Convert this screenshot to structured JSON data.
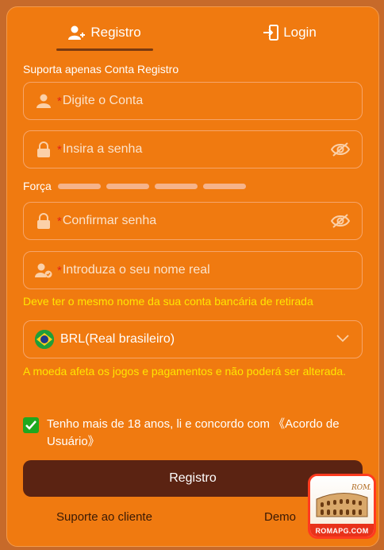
{
  "tabs": {
    "register": "Registro",
    "login": "Login"
  },
  "form": {
    "section_label": "Suporta apenas Conta Registro",
    "required_mark": "*",
    "account_placeholder": "Digite o Conta",
    "password_placeholder": "Insira a senha",
    "strength_label": "Força",
    "confirm_placeholder": "Confirmar senha",
    "realname_placeholder": "Introduza o seu nome real",
    "realname_hint": "Deve ter o mesmo nome da sua conta bancária de retirada",
    "currency_value": "BRL(Real brasileiro)",
    "currency_hint": "A moeda afeta os jogos e pagamentos e não poderá ser alterada.",
    "agree_text": "Tenho mais de 18 anos, li e concordo com ",
    "agree_link": "《Acordo de Usuário》",
    "submit_label": "Registro"
  },
  "footer": {
    "support": "Suporte ao cliente",
    "demo": "Demo"
  },
  "badge": {
    "brand": "ROMAPG.COM",
    "script_text": "ROMA"
  },
  "colors": {
    "panel": "#f07a10",
    "button": "#5b2312",
    "hint": "#ffe600",
    "required": "#e0241a",
    "checkbox": "#1fa81f"
  }
}
